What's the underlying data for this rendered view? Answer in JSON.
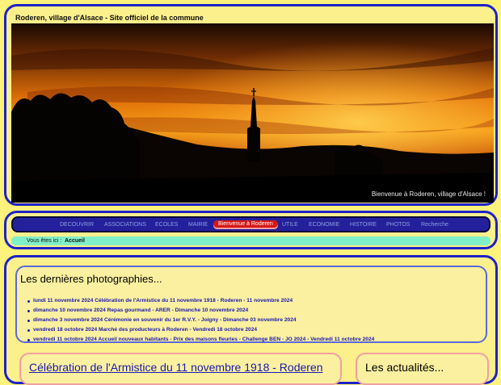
{
  "header": {
    "site_title": "Roderen, village d'Alsace - Site officiel de la commune",
    "banner_caption": "Bienvenue à Roderen, village d'Alsace !"
  },
  "nav": {
    "items": [
      {
        "label": "DECOUVRIR"
      },
      {
        "label": "ASSOCIATIONS"
      },
      {
        "label": "ECOLES"
      },
      {
        "label": "MAIRIE"
      },
      {
        "label": "Bienvenue à Roderen",
        "active": true
      },
      {
        "label": "UTILE"
      },
      {
        "label": "ECONOMIE"
      },
      {
        "label": "HISTOIRE"
      },
      {
        "label": "PHOTOS"
      },
      {
        "label": "Recherche"
      }
    ]
  },
  "breadcrumb": {
    "label": "Vous êtes ici :",
    "current": "Accueil"
  },
  "photos": {
    "title": "Les dernières photographies...",
    "items": [
      "lundi 11 novembre 2024 Célébration de l'Armistice du 11 novembre 1918 - Roderen - 11 novembre 2024",
      "dimanche 10 novembre 2024 Repas gourmand - ARER - Dimanche 10 novembre 2024",
      "dimanche 3 novembre 2024 Cérémonie en souvenir du 1er R.V.Y. - Joigny - Dimanche 03 novembre 2024",
      "vendredi 18 octobre 2024 Marché des producteurs à Roderen - Vendredi 18 octobre 2024",
      "vendredi 11 octobre 2024 Accueil nouveaux habitants - Prix des maisons fleuries - Challenge BEN - JO 2024 - Vendredi 11 octobre 2024"
    ]
  },
  "article": {
    "title": "Célébration de l'Armistice du 11 novembre 1918 - Roderen"
  },
  "news": {
    "title": "Les actualités..."
  },
  "colors": {
    "page_bg": "#fdf27a",
    "frame_border": "#1e22c8",
    "nav_bg": "#24209c",
    "nav_active": "#d61818",
    "breadcrumb_bg": "#80f0c8",
    "link": "#1a1ab0"
  }
}
